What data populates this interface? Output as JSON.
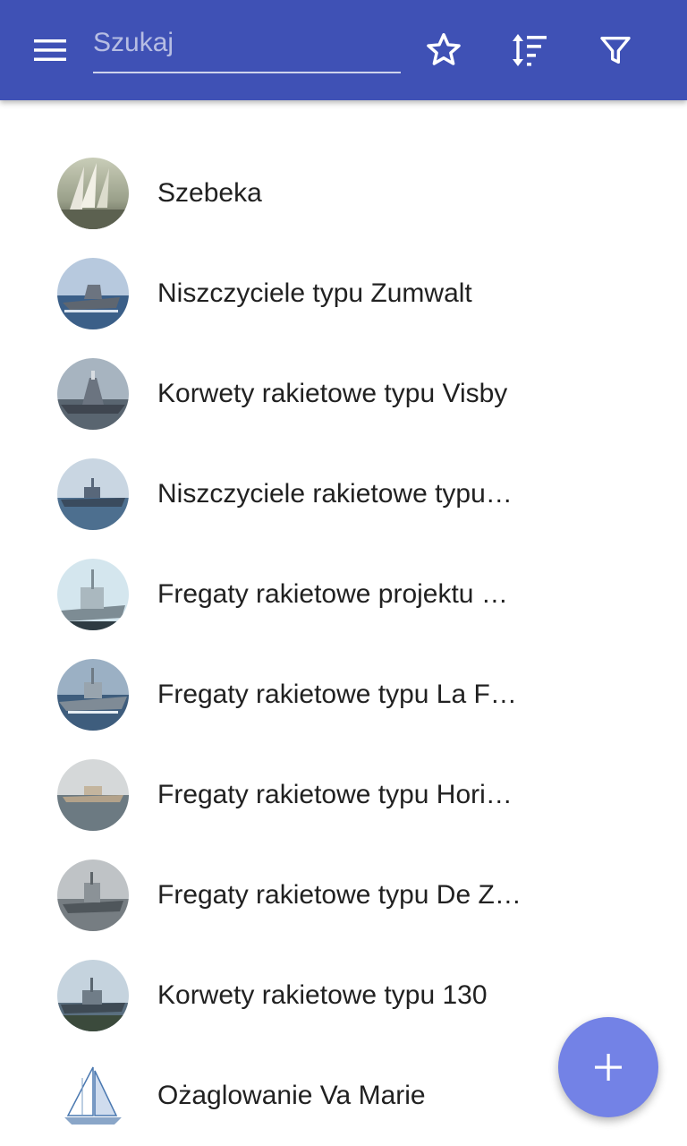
{
  "header": {
    "search": {
      "placeholder": "Szukaj",
      "value": ""
    },
    "actions": [
      {
        "icon": "menu-icon"
      },
      {
        "icon": "star-outline-icon"
      },
      {
        "icon": "sort-icon"
      },
      {
        "icon": "filter-icon"
      }
    ]
  },
  "list": {
    "items": [
      {
        "label": "Szebeka",
        "avatar": "painting"
      },
      {
        "label": "Niszczyciele typu Zumwalt",
        "avatar": "ship-photo"
      },
      {
        "label": "Korwety rakietowe typu Visby",
        "avatar": "ship-photo"
      },
      {
        "label": "Niszczyciele rakietowe typu…",
        "avatar": "ship-photo"
      },
      {
        "label": "Fregaty rakietowe projektu …",
        "avatar": "ship-photo"
      },
      {
        "label": "Fregaty rakietowe typu La F…",
        "avatar": "ship-photo"
      },
      {
        "label": "Fregaty rakietowe typu Hori…",
        "avatar": "ship-photo"
      },
      {
        "label": "Fregaty rakietowe typu De Z…",
        "avatar": "ship-photo"
      },
      {
        "label": "Korwety rakietowe typu 130",
        "avatar": "ship-photo"
      },
      {
        "label": "Ożaglowanie Va Marie",
        "avatar": "sail-drawing"
      }
    ]
  },
  "fab": {
    "icon": "plus-icon"
  },
  "colors": {
    "appbar": "#3f51b5",
    "fab": "#7382e6",
    "text": "#212121"
  }
}
